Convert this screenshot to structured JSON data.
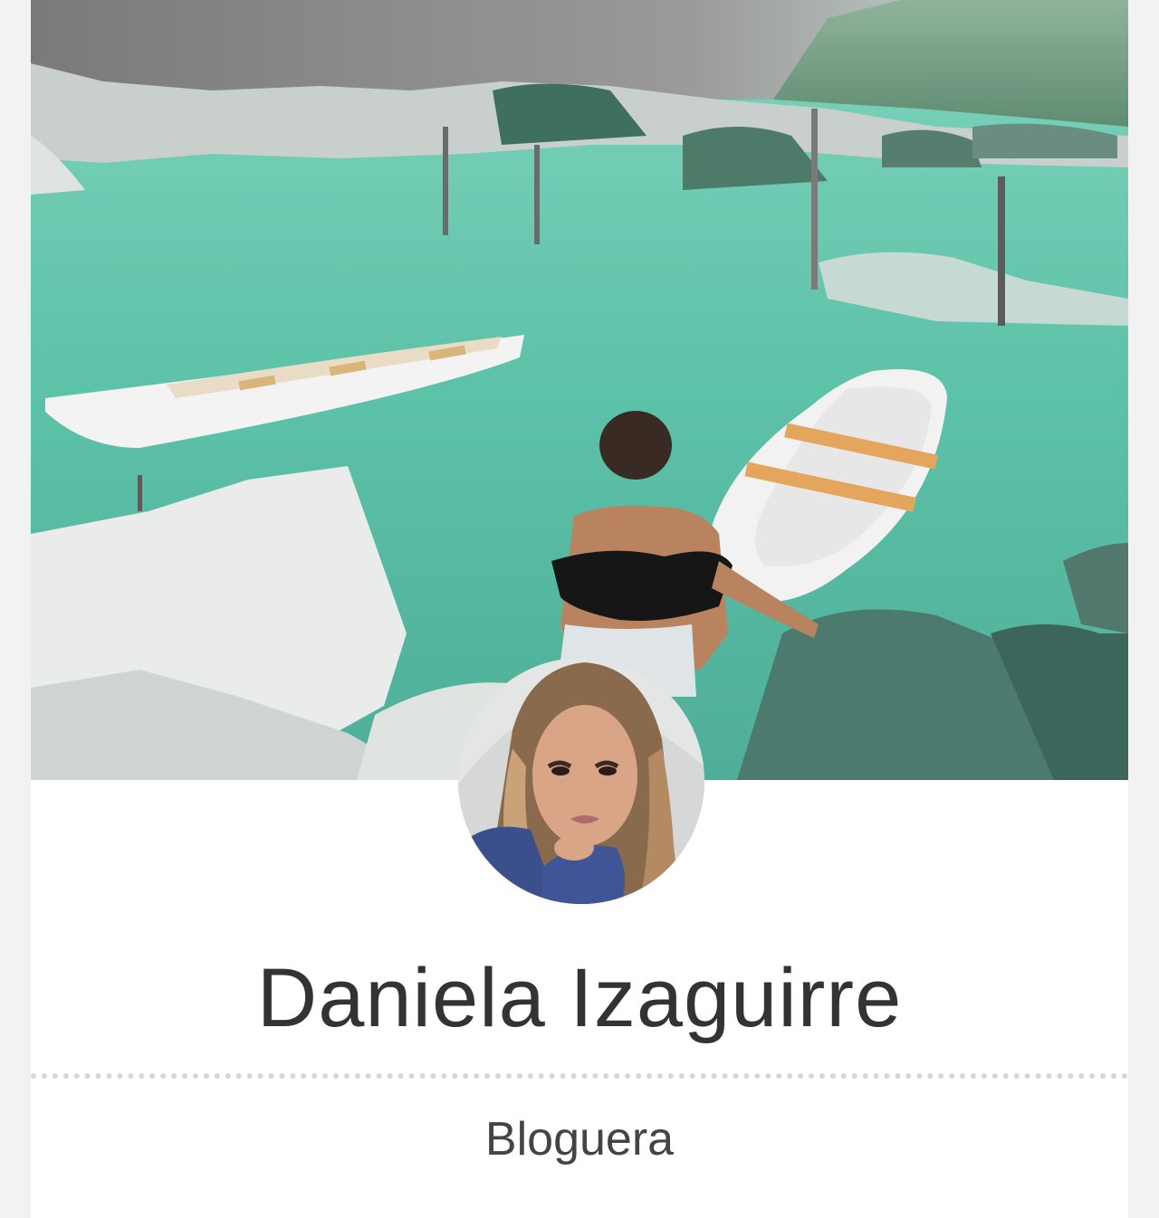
{
  "profile": {
    "name": "Daniela Izaguirre",
    "role": "Bloguera"
  },
  "colors": {
    "page_background": "#f2f2f2",
    "card_background": "#ffffff",
    "name_text": "#333333",
    "role_text": "#444444",
    "divider": "#d6d6d6",
    "lake": "#5fbfa6"
  }
}
